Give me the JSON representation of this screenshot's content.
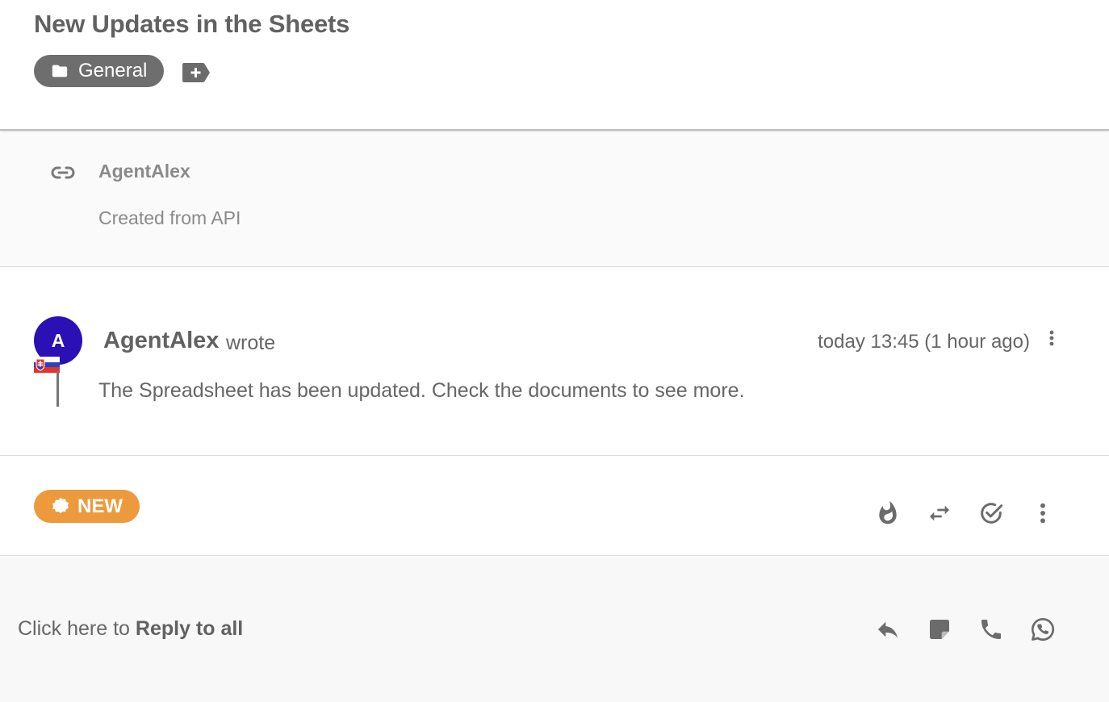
{
  "ticket": {
    "title": "New Updates in the Sheets",
    "department": "General"
  },
  "source": {
    "agent": "AgentAlex",
    "note": "Created from API"
  },
  "message": {
    "avatar_letter": "A",
    "author": "AgentAlex",
    "verb": "wrote",
    "time": "today 13:45 (1 hour ago)",
    "body": "The Spreadsheet has been updated. Check the documents to see more."
  },
  "status": {
    "label": "NEW",
    "color": "#ec9a3c"
  },
  "reply": {
    "prefix": "Click here to ",
    "action": "Reply to all"
  },
  "icons": {
    "department": "folder-icon",
    "add_tag": "add-tag-icon",
    "source": "link-icon",
    "flag": "slovakia-flag-icon",
    "status": "badge-icon",
    "priority": "fire-icon",
    "transfer": "transfer-icon",
    "resolve": "check-circle-icon",
    "more": "more-vertical-icon",
    "reply": "reply-icon",
    "note": "note-icon",
    "call": "phone-icon",
    "whatsapp": "whatsapp-icon"
  },
  "colors": {
    "avatar": "#2a10b5",
    "chip": "#6e6e6e",
    "icon": "#6b6b6b"
  }
}
